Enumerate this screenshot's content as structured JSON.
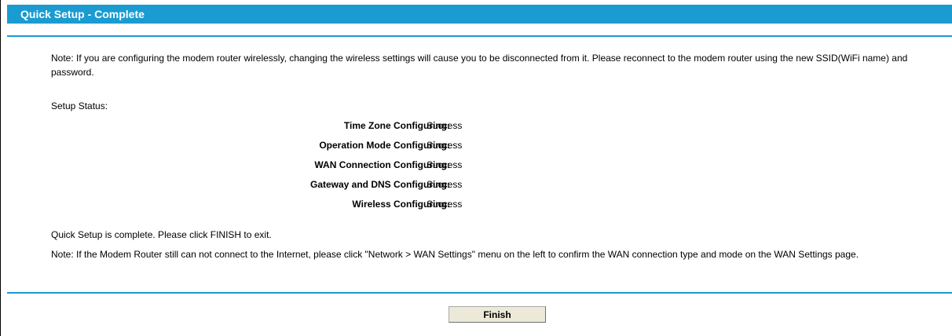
{
  "header": {
    "title": "Quick Setup - Complete"
  },
  "note1": "Note: If you are configuring the modem router wirelessly, changing the wireless settings will cause you to be disconnected from it. Please reconnect to the modem router using the new SSID(WiFi name) and password.",
  "setup_status_label": "Setup Status:",
  "status_items": [
    {
      "label": "Time Zone Configuring:",
      "value": "Success"
    },
    {
      "label": "Operation Mode Configuring:",
      "value": "Success"
    },
    {
      "label": "WAN Connection Configuring:",
      "value": "Success"
    },
    {
      "label": "Gateway and DNS Configuring:",
      "value": "Success"
    },
    {
      "label": "Wireless Configuring:",
      "value": "Success"
    }
  ],
  "complete_text": "Quick Setup is complete. Please click FINISH to exit.",
  "note2": "Note: If the Modem Router still can not connect to the Internet, please click \"Network > WAN Settings\" menu on the left to confirm the WAN connection type and mode on the WAN Settings page.",
  "finish_button_label": "Finish",
  "colors": {
    "accent": "#1a9bd1"
  }
}
